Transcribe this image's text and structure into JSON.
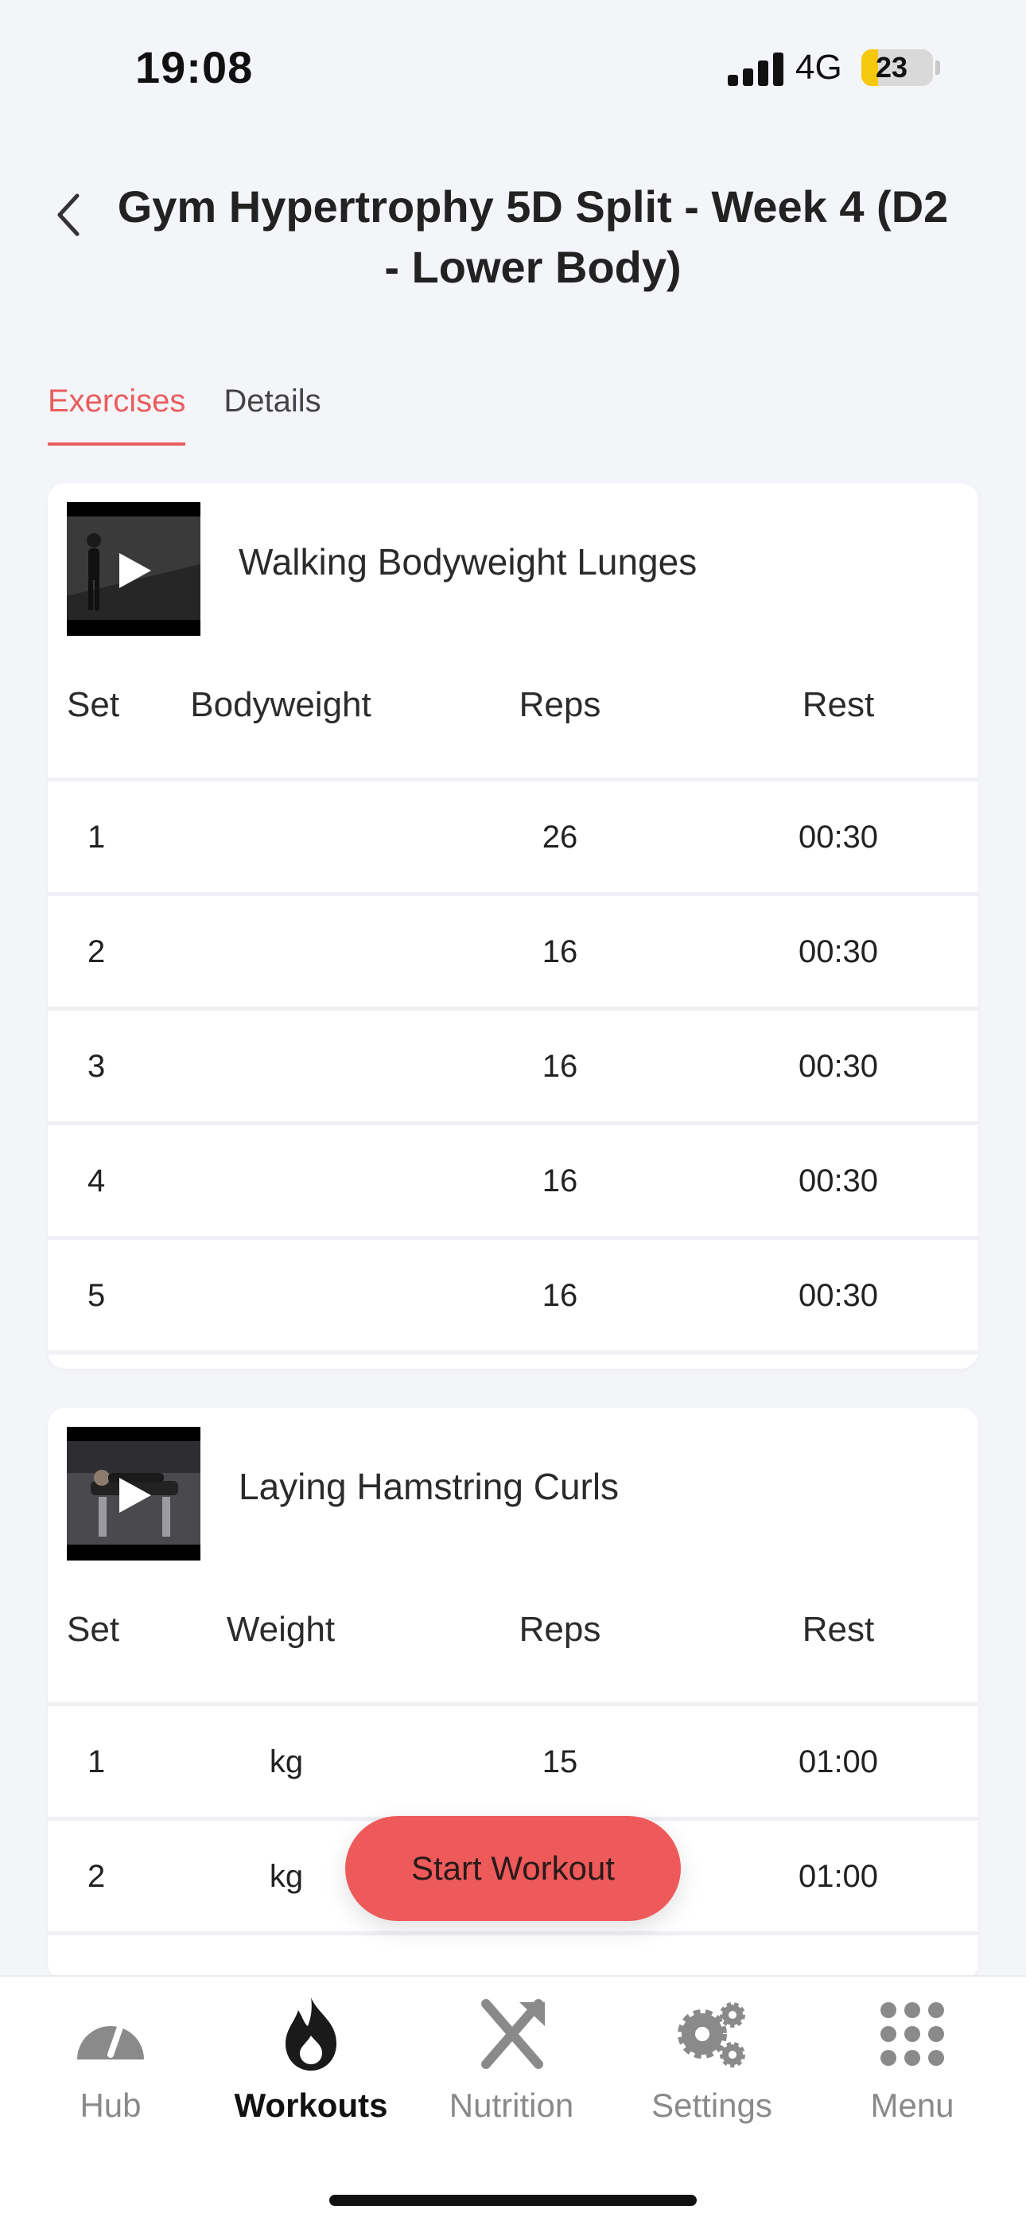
{
  "status_bar": {
    "time": "19:08",
    "network": "4G",
    "battery": "23",
    "battery_level": 0.23
  },
  "header": {
    "title": "Gym Hypertrophy 5D Split - Week 4 (D2 - Lower Body)",
    "back_icon": "chevron-left-icon"
  },
  "tabs": [
    {
      "label": "Exercises",
      "active": true
    },
    {
      "label": "Details",
      "active": false
    }
  ],
  "colors": {
    "accent": "#ee5a5a",
    "active_tab": "#e95d5d",
    "background": "#f4f5f9"
  },
  "exercises": [
    {
      "name": "Walking Bodyweight Lunges",
      "columns": {
        "set": "Set",
        "weight": "Bodyweight",
        "reps": "Reps",
        "rest": "Rest"
      },
      "rows": [
        {
          "set": "1",
          "weight": "",
          "reps": "26",
          "rest": "00:30"
        },
        {
          "set": "2",
          "weight": "",
          "reps": "16",
          "rest": "00:30"
        },
        {
          "set": "3",
          "weight": "",
          "reps": "16",
          "rest": "00:30"
        },
        {
          "set": "4",
          "weight": "",
          "reps": "16",
          "rest": "00:30"
        },
        {
          "set": "5",
          "weight": "",
          "reps": "16",
          "rest": "00:30"
        }
      ]
    },
    {
      "name": "Laying Hamstring Curls",
      "columns": {
        "set": "Set",
        "weight": "Weight",
        "reps": "Reps",
        "rest": "Rest"
      },
      "rows": [
        {
          "set": "1",
          "weight": "kg",
          "reps": "15",
          "rest": "01:00"
        },
        {
          "set": "2",
          "weight": "kg",
          "reps": "",
          "rest": "01:00"
        }
      ]
    }
  ],
  "start_button": "Start Workout",
  "bottom_nav": [
    {
      "label": "Hub",
      "icon": "gauge-icon",
      "active": false
    },
    {
      "label": "Workouts",
      "icon": "flame-icon",
      "active": true
    },
    {
      "label": "Nutrition",
      "icon": "fork-knife-icon",
      "active": false
    },
    {
      "label": "Settings",
      "icon": "gears-icon",
      "active": false
    },
    {
      "label": "Menu",
      "icon": "grid-dots-icon",
      "active": false
    }
  ]
}
